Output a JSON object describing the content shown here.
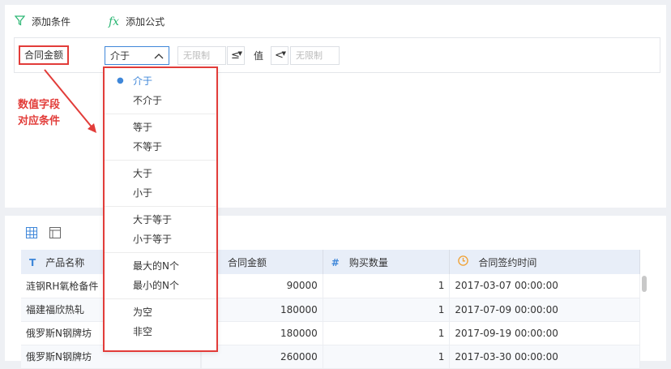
{
  "toolbar": {
    "add_condition": "添加条件",
    "add_formula": "添加公式"
  },
  "filter": {
    "field_label": "合同金额",
    "operator_selected": "介于",
    "min_placeholder": "无限制",
    "min_op": "≤",
    "value_label": "值",
    "max_op": "<",
    "max_placeholder": "无限制"
  },
  "dropdown": {
    "groups": [
      [
        "介于",
        "不介于"
      ],
      [
        "等于",
        "不等于"
      ],
      [
        "大于",
        "小于"
      ],
      [
        "大于等于",
        "小于等于"
      ],
      [
        "最大的N个",
        "最小的N个"
      ],
      [
        "为空",
        "非空"
      ]
    ],
    "selected": "介于"
  },
  "annotation": {
    "line1": "数值字段",
    "line2": "对应条件"
  },
  "table": {
    "headers": [
      {
        "icon": "T",
        "label": "产品名称"
      },
      {
        "icon": "",
        "label": ""
      },
      {
        "icon": "",
        "label": "合同金额"
      },
      {
        "icon": "#",
        "label": "购买数量"
      },
      {
        "icon": "clock",
        "label": "合同签约时间"
      }
    ],
    "rows": [
      [
        "涟钢RH氧枪备件",
        "",
        "90000",
        "1",
        "2017-03-07 00:00:00"
      ],
      [
        "福建福欣热轧",
        "",
        "180000",
        "1",
        "2017-07-09 00:00:00"
      ],
      [
        "俄罗斯N钢牌坊",
        "",
        "180000",
        "1",
        "2017-09-19 00:00:00"
      ],
      [
        "俄罗斯N钢牌坊",
        "",
        "260000",
        "1",
        "2017-03-30 00:00:00"
      ]
    ]
  },
  "colors": {
    "accent": "#3f87d9",
    "highlight": "#e23c39",
    "formula": "#2bb673"
  }
}
